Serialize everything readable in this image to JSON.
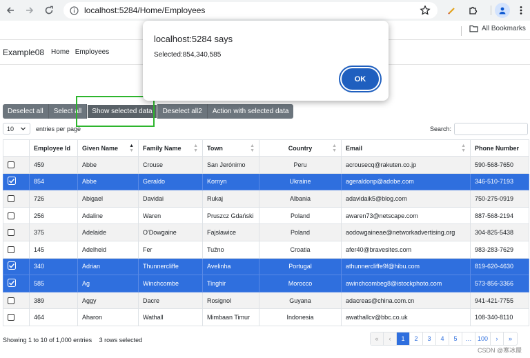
{
  "browser": {
    "url": "localhost:5284/Home/Employees",
    "bookmarks_label": "All Bookmarks"
  },
  "navbar": {
    "brand": "Example08",
    "links": [
      "Home",
      "Employees"
    ]
  },
  "toolbar": {
    "buttons": [
      "Deselect all",
      "Select all",
      "Show selected data",
      "Deselect all2",
      "Action with selected data"
    ]
  },
  "table_controls": {
    "page_length": "10",
    "entries_label": "entries per page",
    "search_label": "Search:",
    "search_value": ""
  },
  "table": {
    "headers": [
      "",
      "Employee Id",
      "Given Name",
      "Family Name",
      "Town",
      "Country",
      "Email",
      "Phone Number"
    ],
    "rows": [
      {
        "selected": false,
        "cells": [
          "459",
          "Abbe",
          "Crouse",
          "San Jerónimo",
          "Peru",
          "acrousecq@rakuten.co.jp",
          "590-568-7650"
        ]
      },
      {
        "selected": true,
        "cells": [
          "854",
          "Abbe",
          "Geraldo",
          "Kornyn",
          "Ukraine",
          "ageraldonp@adobe.com",
          "346-510-7193"
        ]
      },
      {
        "selected": false,
        "cells": [
          "726",
          "Abigael",
          "Davidai",
          "Rukaj",
          "Albania",
          "adavidaik5@blog.com",
          "750-275-0919"
        ]
      },
      {
        "selected": false,
        "cells": [
          "256",
          "Adaline",
          "Waren",
          "Pruszcz Gdański",
          "Poland",
          "awaren73@netscape.com",
          "887-568-2194"
        ]
      },
      {
        "selected": false,
        "cells": [
          "375",
          "Adelaide",
          "O'Dowgaine",
          "Fajsławice",
          "Poland",
          "aodowgaineae@networkadvertising.org",
          "304-825-5438"
        ]
      },
      {
        "selected": false,
        "cells": [
          "145",
          "Adelheid",
          "Fer",
          "Tužno",
          "Croatia",
          "afer40@bravesites.com",
          "983-283-7629"
        ]
      },
      {
        "selected": true,
        "cells": [
          "340",
          "Adrian",
          "Thunnercliffe",
          "Avelinha",
          "Portugal",
          "athunnercliffe9f@hibu.com",
          "819-620-4630"
        ]
      },
      {
        "selected": true,
        "cells": [
          "585",
          "Ag",
          "Winchcombe",
          "Tinghir",
          "Morocco",
          "awinchcombeg8@istockphoto.com",
          "573-856-3366"
        ]
      },
      {
        "selected": false,
        "cells": [
          "389",
          "Aggy",
          "Dacre",
          "Rosignol",
          "Guyana",
          "adacreas@china.com.cn",
          "941-421-7755"
        ]
      },
      {
        "selected": false,
        "cells": [
          "464",
          "Aharon",
          "Wathall",
          "Mimbaan Timur",
          "Indonesia",
          "awathallcv@bbc.co.uk",
          "108-340-8110"
        ]
      }
    ]
  },
  "footer": {
    "info": "Showing 1 to 10 of 1,000 entries",
    "selected_info": "3 rows selected",
    "pages": [
      "«",
      "‹",
      "1",
      "2",
      "3",
      "4",
      "5",
      "…",
      "100",
      "›",
      "»"
    ],
    "active_page": "1"
  },
  "dialog": {
    "title": "localhost:5284 says",
    "message": "Selected:854,340,585",
    "ok_label": "OK"
  },
  "watermark": "CSDN @寒冰屋",
  "colors": {
    "selected_row": "#2f6fde",
    "button_group": "#6c757d",
    "highlight_box": "#2db52d",
    "dialog_ok": "#1f5fbf"
  }
}
